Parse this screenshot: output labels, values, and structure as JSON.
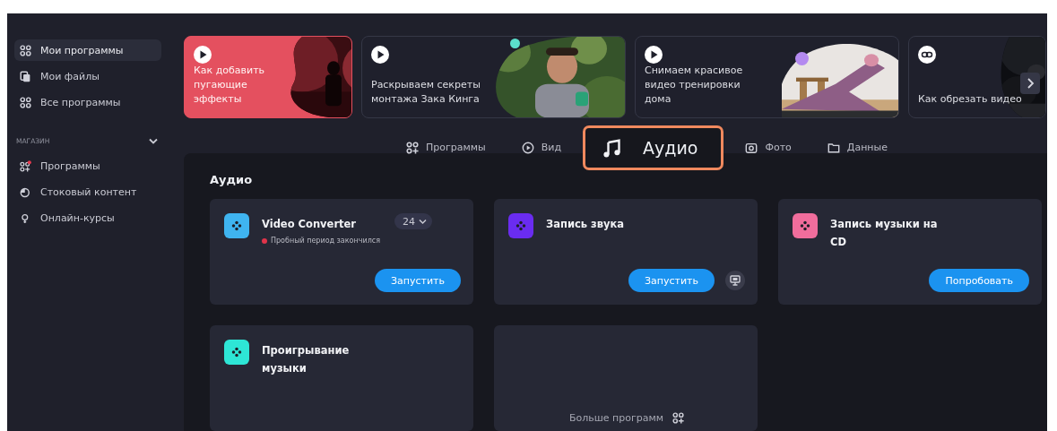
{
  "sidebar": {
    "items": [
      {
        "label": "Мои программы",
        "selected": true
      },
      {
        "label": "Мои файлы",
        "selected": false
      },
      {
        "label": "Все программы",
        "selected": false
      }
    ],
    "store": {
      "title": "МАГАЗИН",
      "expanded": true,
      "items": [
        {
          "label": "Программы",
          "badge": true
        },
        {
          "label": "Стоковый контент",
          "badge": false
        },
        {
          "label": "Онлайн-курсы",
          "badge": false
        }
      ]
    }
  },
  "banners": [
    {
      "text": "Как добавить пугающие эффекты",
      "kind": "video",
      "color": "#e4505f"
    },
    {
      "text": "Раскрываем секреты монтажа Зака Кинга",
      "kind": "video",
      "color": "#1f202c"
    },
    {
      "text": "Снимаем красивое видео тренировки дома",
      "kind": "video",
      "color": "#1f202c"
    },
    {
      "text": "Как обрезать видео",
      "kind": "link",
      "color": "#1f202c"
    }
  ],
  "tabs": [
    {
      "label": "Программы",
      "selected": false
    },
    {
      "label": "Вид",
      "selected": false
    },
    {
      "label": "Аудио",
      "selected": true
    },
    {
      "label": "Фото",
      "selected": false
    },
    {
      "label": "Данные",
      "selected": false
    }
  ],
  "section": {
    "title": "Аудио",
    "apps": [
      {
        "name": "Video Converter",
        "color": "#3fb4f0",
        "version": "24",
        "status": "Пробный период закончился",
        "button": "Запустить",
        "screen_button": false
      },
      {
        "name": "Запись звука",
        "color": "#6a2cf0",
        "button": "Запустить",
        "screen_button": true
      },
      {
        "name": "Запись музыки на CD",
        "color": "#f06d9c",
        "button": "Попробовать",
        "screen_button": false
      },
      {
        "name": "Проигрывание музыки",
        "color": "#2ee6d6",
        "screen_button": false
      }
    ],
    "more": "Больше программ"
  }
}
